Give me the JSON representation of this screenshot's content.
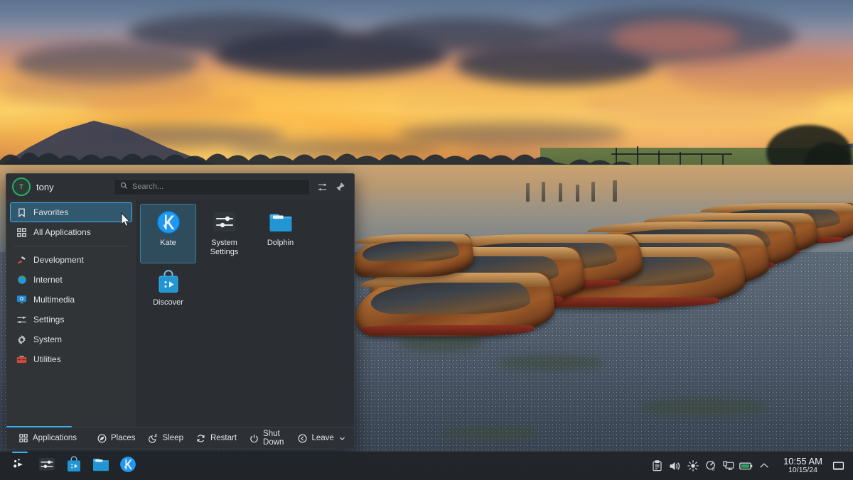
{
  "desktop": {
    "wallpaper_name": "derwentwater-boats-sunset",
    "accent_color": "#3daee9",
    "panel_color": "#202328"
  },
  "kickoff": {
    "user": {
      "name": "tony",
      "avatar_initial": "T",
      "avatar_icon": "user-avatar"
    },
    "search": {
      "placeholder": "Search...",
      "value": "",
      "icon": "search-icon"
    },
    "header_buttons": [
      {
        "name": "configure-icon",
        "label": "Configure"
      },
      {
        "name": "pin-icon",
        "label": "Pin"
      }
    ],
    "sidebar": {
      "items": [
        {
          "label": "Favorites",
          "icon": "bookmark-icon",
          "selected": true
        },
        {
          "label": "All Applications",
          "icon": "grid-icon",
          "selected": false
        },
        {
          "label": "Development",
          "icon": "hammer-icon",
          "selected": false
        },
        {
          "label": "Internet",
          "icon": "globe-icon",
          "selected": false
        },
        {
          "label": "Multimedia",
          "icon": "media-icon",
          "selected": false
        },
        {
          "label": "Settings",
          "icon": "sliders-icon",
          "selected": false
        },
        {
          "label": "System",
          "icon": "gear-icon",
          "selected": false
        },
        {
          "label": "Utilities",
          "icon": "toolbox-icon",
          "selected": false
        }
      ]
    },
    "apps": [
      {
        "label": "Kate",
        "icon": "kate-icon",
        "selected": true
      },
      {
        "label": "System Settings",
        "icon": "system-settings-icon",
        "selected": false
      },
      {
        "label": "Dolphin",
        "icon": "dolphin-icon",
        "selected": false
      },
      {
        "label": "Discover",
        "icon": "discover-icon",
        "selected": false
      }
    ],
    "footer": {
      "tabs": [
        {
          "label": "Applications",
          "icon": "grid-icon",
          "active": true
        },
        {
          "label": "Places",
          "icon": "compass-icon",
          "active": false
        }
      ],
      "power": [
        {
          "label": "Sleep",
          "icon": "sleep-icon"
        },
        {
          "label": "Restart",
          "icon": "restart-icon"
        },
        {
          "label": "Shut Down",
          "icon": "power-icon"
        },
        {
          "label": "Leave",
          "icon": "leave-icon",
          "has_chevron": true
        }
      ]
    }
  },
  "taskbar": {
    "launchers": [
      {
        "label": "Application Launcher",
        "icon": "kickoff-icon",
        "active": true
      },
      {
        "label": "System Settings",
        "icon": "system-settings-icon",
        "active": false
      },
      {
        "label": "Discover",
        "icon": "discover-icon",
        "active": false
      },
      {
        "label": "Dolphin",
        "icon": "dolphin-icon",
        "active": false
      },
      {
        "label": "Kate",
        "icon": "kate-icon",
        "active": false
      }
    ],
    "tray": [
      {
        "name": "clipboard-icon",
        "label": "Clipboard"
      },
      {
        "name": "volume-icon",
        "label": "Audio Volume"
      },
      {
        "name": "brightness-icon",
        "label": "Brightness"
      },
      {
        "name": "disk-icon",
        "label": "Disk Usage"
      },
      {
        "name": "display-icon",
        "label": "Display Configuration"
      },
      {
        "name": "battery-icon",
        "label": "Battery"
      },
      {
        "name": "chevron-up-icon",
        "label": "Show hidden icons"
      }
    ],
    "clock": {
      "time": "10:55 AM",
      "date": "10/15/24"
    },
    "show_desktop": {
      "name": "show-desktop-icon",
      "label": "Show Desktop"
    }
  }
}
